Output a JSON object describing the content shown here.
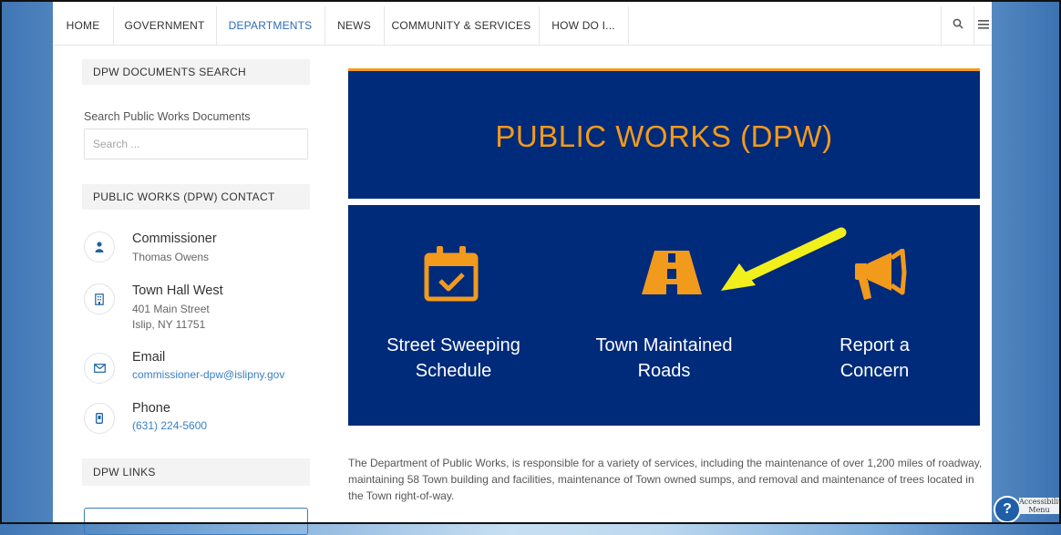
{
  "nav": {
    "items": [
      "HOME",
      "GOVERNMENT",
      "DEPARTMENTS",
      "NEWS",
      "COMMUNITY & SERVICES",
      "HOW DO I..."
    ],
    "active": "DEPARTMENTS",
    "search_icon": "search-icon",
    "menu_icon": "hamburger-menu-icon"
  },
  "sidebar": {
    "docs_heading": "DPW DOCUMENTS SEARCH",
    "search_label": "Search Public Works Documents",
    "search_placeholder": "Search ...",
    "contact_heading": "PUBLIC WORKS (DPW) CONTACT",
    "contacts": [
      {
        "icon": "person-icon",
        "title": "Commissioner",
        "lines": [
          "Thomas Owens"
        ]
      },
      {
        "icon": "building-icon",
        "title": "Town Hall West",
        "lines": [
          "401 Main Street",
          "Islip, NY 11751"
        ]
      },
      {
        "icon": "envelope-icon",
        "title": "Email",
        "link": "commissioner-dpw@islipny.gov"
      },
      {
        "icon": "phone-icon",
        "title": "Phone",
        "link": "(631) 224-5600"
      }
    ],
    "links_heading": "DPW LINKS"
  },
  "banner": {
    "title": "PUBLIC WORKS (DPW)",
    "tiles": [
      {
        "icon": "calendar-check-icon",
        "line1": "Street Sweeping",
        "line2": "Schedule"
      },
      {
        "icon": "road-icon",
        "line1": "Town Maintained",
        "line2": "Roads"
      },
      {
        "icon": "megaphone-icon",
        "line1": "Report a",
        "line2": "Concern"
      }
    ]
  },
  "description": "The Department of Public Works, is responsible for a variety of services, including the maintenance of over 1,200 miles of roadway, maintaining 58 Town building and facilities, maintenance of Town owned sumps, and removal and maintenance of trees located in the Town right-of-way.",
  "accessibility": {
    "line1": "Accessibilit",
    "line2": "Menu"
  },
  "colors": {
    "navy": "#002a7a",
    "orange": "#f29a1c",
    "link": "#3a7fc1",
    "arrow": "#f2f01c"
  }
}
